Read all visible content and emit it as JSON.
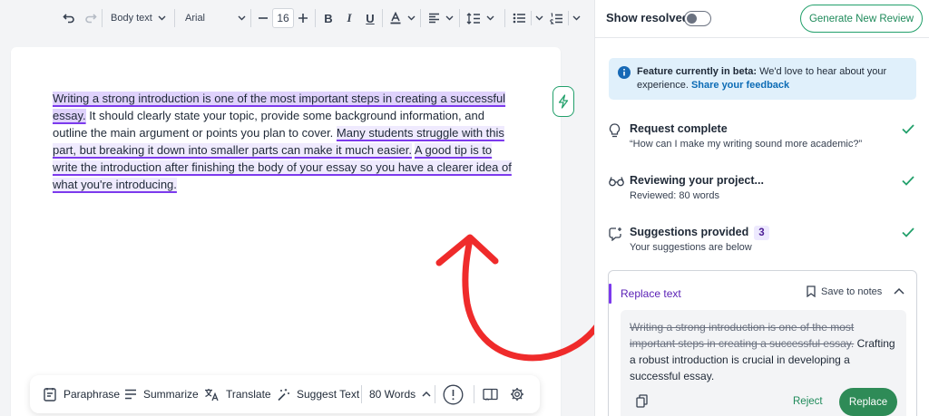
{
  "toolbar": {
    "undo_icon": "undo-icon",
    "redo_icon": "redo-icon",
    "style_select": "Body text",
    "font_select": "Arial",
    "font_size": "16",
    "bold": "B",
    "italic": "I",
    "underline": "U"
  },
  "document": {
    "sentences": [
      "Writing a strong introduction is one of the most important steps in creating a successful essay.",
      " It should clearly state your topic, provide some background information, and outline the main argument or points you plan to cover. ",
      "Many students struggle with this part, but breaking it down into smaller parts can make it much easier.",
      " ",
      "A good tip is to write the introduction after finishing the body of your essay so you have a clearer idea of what you're introducing."
    ]
  },
  "bottom_bar": {
    "paraphrase": "Paraphrase",
    "summarize": "Summarize",
    "translate": "Translate",
    "suggest_text": "Suggest Text",
    "word_count": "80 Words"
  },
  "panel": {
    "show_resolved": "Show resolved",
    "generate_button": "Generate New Review",
    "beta": {
      "title": "Feature currently in beta:",
      "body": " We'd love to hear about your experience. ",
      "link": "Share your feedback"
    },
    "steps": [
      {
        "title": "Request complete",
        "subtitle": "“How can I make my writing sound more academic?”"
      },
      {
        "title": "Reviewing your project...",
        "subtitle": "Reviewed: 80 words"
      },
      {
        "title": "Suggestions provided",
        "count": "3",
        "subtitle": "Your suggestions are below"
      }
    ],
    "card": {
      "title": "Replace text",
      "save_notes": "Save to notes",
      "original": "Writing a strong introduction is one of the most important steps in creating a successful essay.",
      "replacement": "Crafting a robust introduction is crucial in developing a successful essay.",
      "reject": "Reject",
      "replace": "Replace"
    }
  },
  "colors": {
    "accent_green": "#22a06b",
    "highlight_purple": "#7c3aed",
    "arrow_red": "#ef2b2b",
    "beta_bg": "#e0f0fb"
  }
}
